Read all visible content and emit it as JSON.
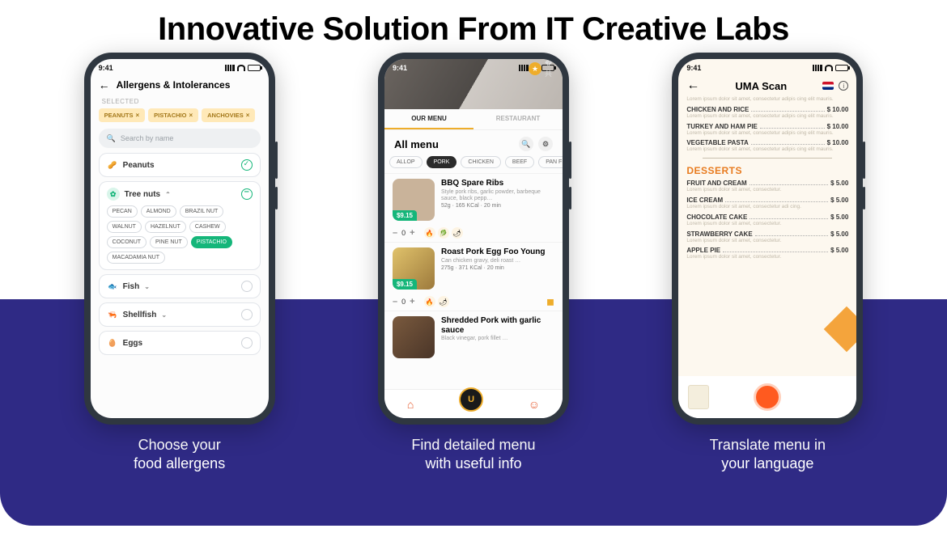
{
  "headline": "Innovative Solution From IT Creative Labs",
  "status_time": "9:41",
  "captions": [
    "Choose your\nfood allergens",
    "Find detailed menu\nwith useful info",
    "Translate menu in\nyour language"
  ],
  "phone1": {
    "title": "Allergens & Intolerances",
    "selected_label": "SELECTED",
    "selected": [
      "PEANUTS",
      "PISTACHIO",
      "ANCHOVIES"
    ],
    "search_placeholder": "Search  by name",
    "rows": {
      "peanuts": "Peanuts",
      "treenuts": "Tree nuts",
      "fish": "Fish",
      "shellfish": "Shellfish",
      "eggs": "Eggs"
    },
    "treenuts_items": [
      "PECAN",
      "ALMOND",
      "BRAZIL NUT",
      "WALNUT",
      "HAZELNUT",
      "CASHEW",
      "COCONUT",
      "PINE NUT",
      "PISTACHIO",
      "MACADAMIA NUT"
    ],
    "treenuts_selected": "PISTACHIO"
  },
  "phone2": {
    "tabs": {
      "menu": "OUR MENU",
      "rest": "RESTAURANT"
    },
    "heading": "All menu",
    "categories": [
      "ALLOP",
      "PORK",
      "CHICKEN",
      "BEEF",
      "PAN FRIED N"
    ],
    "cat_selected": "PORK",
    "items": [
      {
        "name": "BBQ Spare Ribs",
        "desc": "Style pork ribs, garlic powder, barbeque sauce, black pepp…",
        "price": "$9.15",
        "stats": "52g · 165 KCal · 20 min",
        "qty": "0"
      },
      {
        "name": "Roast Pork Egg Foo Young",
        "desc": "Can chicken gravy, deli roast …",
        "price": "$9.15",
        "stats": "275g · 371 KCal · 20 min",
        "qty": "0"
      },
      {
        "name": "Shredded Pork with garlic sauce",
        "desc": "Black vinegar, pork fillet …",
        "price": "",
        "stats": "",
        "qty": ""
      }
    ]
  },
  "phone3": {
    "title": "UMA Scan",
    "lorem": "Lorem ipsum dolor sit amet, consectetur adipis cing elit mauris.",
    "lorem_short": "Lorem ipsum dolor sit amet, consectetur.",
    "lorem_alt": "Lorem ipsum dolor sit amet, consectetur adi cing.",
    "mains": [
      {
        "n": "CHICKEN AND RICE",
        "p": "$ 10.00"
      },
      {
        "n": "TURKEY AND HAM PIE",
        "p": "$ 10.00"
      },
      {
        "n": "VEGETABLE PASTA",
        "p": "$ 10.00"
      }
    ],
    "desserts_label": "DESSERTS",
    "desserts": [
      {
        "n": "FRUIT AND CREAM",
        "p": "$ 5.00"
      },
      {
        "n": "ICE CREAM",
        "p": "$ 5.00"
      },
      {
        "n": "CHOCOLATE CAKE",
        "p": "$ 5.00"
      },
      {
        "n": "STRAWBERRY CAKE",
        "p": "$ 5.00"
      },
      {
        "n": "APPLE PIE",
        "p": "$ 5.00"
      }
    ]
  }
}
